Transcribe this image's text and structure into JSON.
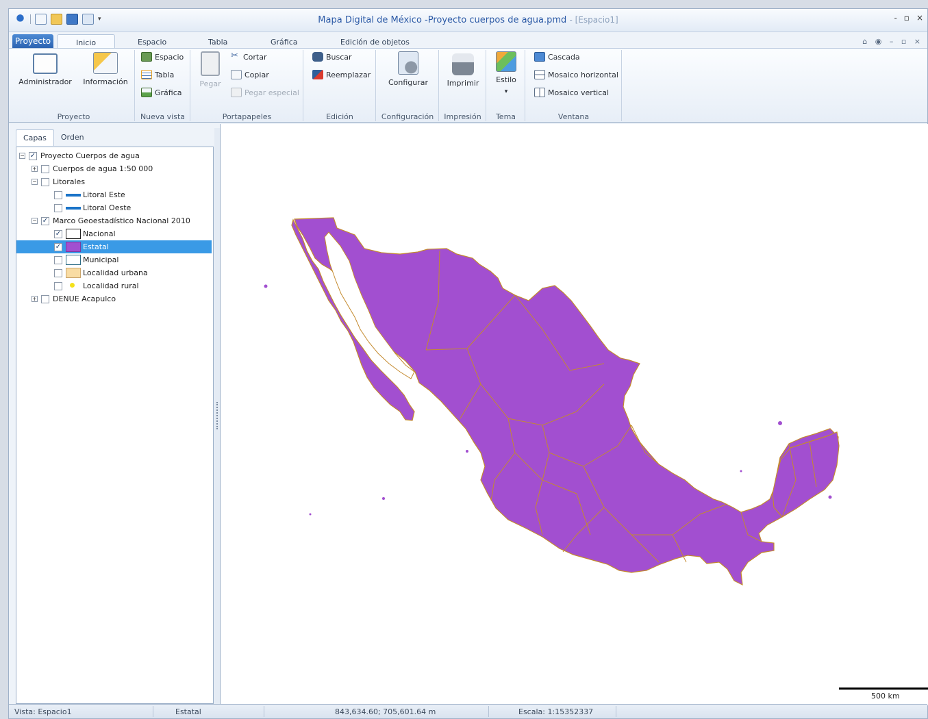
{
  "window": {
    "title_main": "Mapa Digital de México -Proyecto cuerpos de agua.pmd",
    "title_sub": "- [Espacio1]",
    "controls": [
      "-",
      "▫",
      "×"
    ]
  },
  "ribbon": {
    "app_button": "Proyecto",
    "tabs": [
      "Inicio",
      "Espacio",
      "Tabla",
      "Gráfica",
      "Edición de objetos"
    ],
    "right_controls": "⌂ ◉ – ▫ ×",
    "groups": {
      "proyecto": {
        "label": "Proyecto",
        "admin": "Administrador",
        "info": "Información"
      },
      "nueva_vista": {
        "label": "Nueva vista",
        "espacio": "Espacio",
        "tabla": "Tabla",
        "grafica": "Gráfica"
      },
      "portapapeles": {
        "label": "Portapapeles",
        "pegar": "Pegar",
        "cortar": "Cortar",
        "copiar": "Copiar",
        "pegar_especial": "Pegar especial"
      },
      "edicion": {
        "label": "Edición",
        "buscar": "Buscar",
        "reemplazar": "Reemplazar"
      },
      "configuracion": {
        "label": "Configuración",
        "configurar": "Configurar"
      },
      "impresion": {
        "label": "Impresión",
        "imprimir": "Imprimir"
      },
      "tema": {
        "label": "Tema",
        "estilo": "Estilo"
      },
      "ventana": {
        "label": "Ventana",
        "cascada": "Cascada",
        "mosaico_h": "Mosaico horizontal",
        "mosaico_v": "Mosaico vertical"
      }
    }
  },
  "layers_panel": {
    "tabs": [
      "Capas",
      "Orden"
    ],
    "tree": [
      {
        "label": "Proyecto Cuerpos de agua",
        "checked": true,
        "expander": "−"
      },
      {
        "label": "Cuerpos de agua 1:50 000",
        "checked": false,
        "expander": "+"
      },
      {
        "label": "Litorales",
        "checked": false,
        "expander": "−"
      },
      {
        "label": "Litoral Este",
        "checked": false
      },
      {
        "label": "Litoral Oeste",
        "checked": false
      },
      {
        "label": "Marco Geoestadístico Nacional 2010",
        "checked": true,
        "expander": "−"
      },
      {
        "label": "Nacional",
        "checked": true
      },
      {
        "label": "Estatal",
        "checked": true,
        "selected": true
      },
      {
        "label": "Municipal",
        "checked": false
      },
      {
        "label": "Localidad urbana",
        "checked": false
      },
      {
        "label": "Localidad rural",
        "checked": false
      },
      {
        "label": "DENUE Acapulco",
        "checked": false,
        "expander": "+"
      }
    ]
  },
  "map": {
    "fill_color": "#a24fd0",
    "border_color": "#c48a2e",
    "scale_label": "500 km"
  },
  "status": {
    "vista": "Vista: Espacio1",
    "layer": "Estatal",
    "coords": "843,634.60; 705,601.64 m",
    "escala": "Escala: 1:15352337"
  }
}
